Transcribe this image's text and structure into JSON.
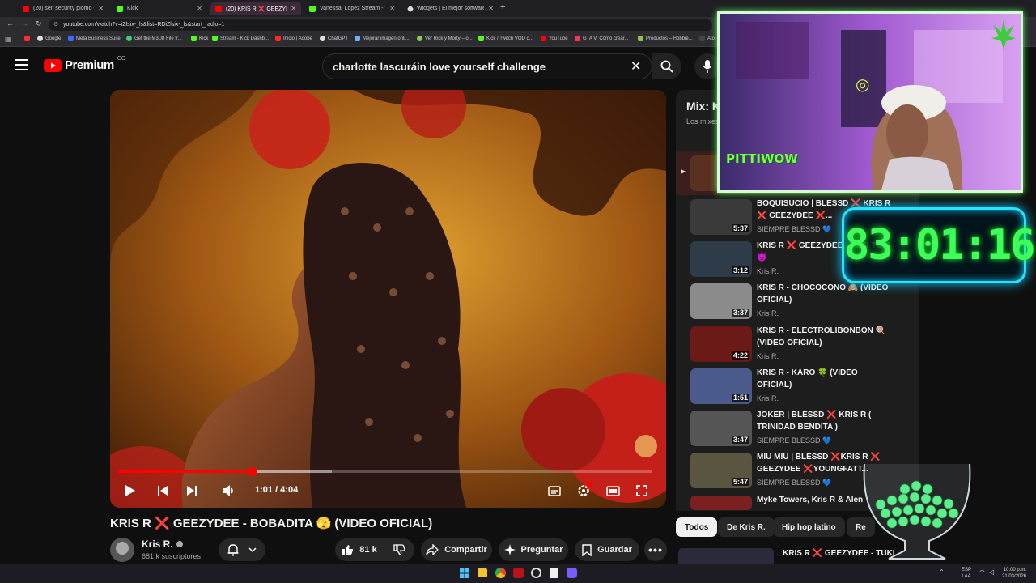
{
  "browser": {
    "tabs": [
      {
        "title": "(20) self security plomo - YouTub",
        "color": "#ff0000"
      },
      {
        "title": "Kick",
        "color": "#53fc18"
      },
      {
        "title": "(20) KRIS R ❌ GEEZYDEE - BO",
        "color": "#ff0000"
      },
      {
        "title": "Vanessa_Lopez Stream - Watch",
        "color": "#53fc18"
      },
      {
        "title": "Widgets | El mejor software pa",
        "color": "#ffffff"
      }
    ],
    "url": "youtube.com/watch?v=iZlsix-_ls&list=RDiZlsix-_ls&start_radio=1",
    "bookmarks": [
      "Google",
      "Meta Business Suite",
      "Get the M3U8 File fr...",
      "Kick",
      "Stream - Kick Dashb...",
      "Inicio | Adobe",
      "ChatGPT",
      "Mejorar imagen onli...",
      "Ver Rick y Morty – o...",
      "Kick / Twitch VOD d...",
      "YouTube",
      "GTA V: Cómo crear...",
      "Productos – Hobbie...",
      "Ato"
    ]
  },
  "header": {
    "logo_text": "Premium",
    "logo_badge": "CO",
    "search_query": "charlotte lascuráin love yourself challenge"
  },
  "player": {
    "time": "1:01 / 4:04",
    "progress": 0.25
  },
  "video": {
    "title": "KRIS R ❌ GEEZYDEE - BOBADITA 🫣 (VIDEO OFICIAL)",
    "channel": "Kris R.",
    "subscribers": "681 k suscriptores",
    "likes": "81 k",
    "share_label": "Compartir",
    "ask_label": "Preguntar",
    "save_label": "Guardar"
  },
  "playlist": {
    "title": "Mix: K",
    "subtitle": "Los mixes",
    "items": [
      {
        "title": "BOQUISUCIO | BLESSD ❌ KRIS R ❌ GEEZYDEE ❌...",
        "channel": "SIEMPRE BLESSD 💙",
        "duration": "5:37",
        "thumb": "#3a3a3a"
      },
      {
        "title": "KRIS R ❌ GEEZYDEE - TUKI TUKI 👿",
        "channel": "Kris R.",
        "duration": "3:12",
        "thumb": "#2e3b48"
      },
      {
        "title": "KRIS R - CHOCOCONO 🙈 (VIDEO OFICIAL)",
        "channel": "Kris R.",
        "duration": "3:37",
        "thumb": "#8b8b8b"
      },
      {
        "title": "KRIS R - ELECTROLIBONBON 🍭 (VIDEO OFICIAL)",
        "channel": "Kris R.",
        "duration": "4:22",
        "thumb": "#6b1a18"
      },
      {
        "title": "KRIS R - KARO 🍀 (VIDEO OFICIAL)",
        "channel": "Kris R.",
        "duration": "1:51",
        "thumb": "#4a5a8a"
      },
      {
        "title": "JOKER | BLESSD ❌ KRIS R ( TRINIDAD BENDITA )",
        "channel": "SIEMPRE BLESSD 💙",
        "duration": "3:47",
        "thumb": "#555555"
      },
      {
        "title": "MIU MIU | BLESSD ❌KRIS R ❌ GEEZYDEE ❌YOUNGFATT...",
        "channel": "SIEMPRE BLESSD 💙",
        "duration": "5:47",
        "thumb": "#5a5540"
      },
      {
        "title": "Myke Towers, Kris R & Alen",
        "channel": "",
        "duration": "",
        "thumb": "#7a2020"
      }
    ]
  },
  "chips": [
    "Todos",
    "De Kris R.",
    "Hip hop latino",
    "Re"
  ],
  "next_video": "KRIS R ❌ GEEZYDEE - TUKI",
  "overlay": {
    "timer": "83:01:16",
    "webcam_label": "PITTIWOW"
  },
  "taskbar": {
    "lang": "ESP",
    "lang2": "LAA",
    "time": "10:00 p.m.",
    "date": "21/03/2026"
  }
}
